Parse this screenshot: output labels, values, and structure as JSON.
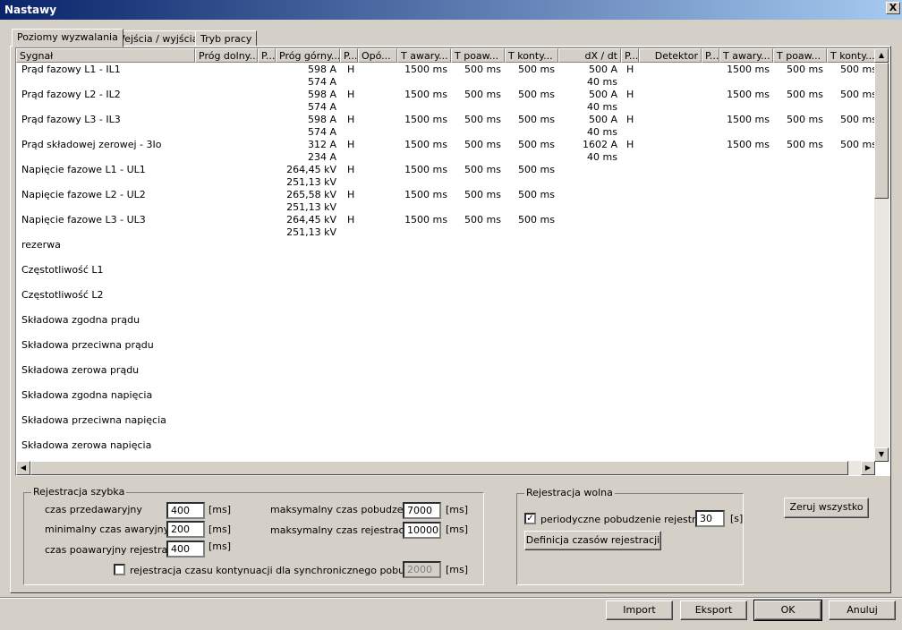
{
  "window": {
    "title": "Nastawy",
    "close_label": "X"
  },
  "tabs": [
    "Poziomy wyzwalania",
    "Wejścia / wyjścia",
    "Tryb pracy"
  ],
  "grid": {
    "headers": [
      "Sygnał",
      "Próg dolny...",
      "P...",
      "Próg górny...",
      "P...",
      "Opó...",
      "T awary...",
      "T poaw...",
      "T konty...",
      "dX / dt",
      "P...",
      "Detektor",
      "P...",
      "T awary...",
      "T poaw...",
      "T konty..."
    ],
    "rows": [
      {
        "signal": "Prąd fazowy L1 - IL1",
        "prog_gorny": "598 A",
        "prog_gorny2": "574 A",
        "p2": "H",
        "t_awar": "1500 ms",
        "t_poaw": "500 ms",
        "t_kont": "500 ms",
        "dxdt": "500 A",
        "dxdt2": "40 ms",
        "p3": "H",
        "t_awar2": "1500 ms",
        "t_poaw2": "500 ms",
        "t_kont2": "500 ms"
      },
      {
        "signal": "Prąd fazowy L2 - IL2",
        "prog_gorny": "598 A",
        "prog_gorny2": "574 A",
        "p2": "H",
        "t_awar": "1500 ms",
        "t_poaw": "500 ms",
        "t_kont": "500 ms",
        "dxdt": "500 A",
        "dxdt2": "40 ms",
        "p3": "H",
        "t_awar2": "1500 ms",
        "t_poaw2": "500 ms",
        "t_kont2": "500 ms"
      },
      {
        "signal": "Prąd fazowy L3 - IL3",
        "prog_gorny": "598 A",
        "prog_gorny2": "574 A",
        "p2": "H",
        "t_awar": "1500 ms",
        "t_poaw": "500 ms",
        "t_kont": "500 ms",
        "dxdt": "500 A",
        "dxdt2": "40 ms",
        "p3": "H",
        "t_awar2": "1500 ms",
        "t_poaw2": "500 ms",
        "t_kont2": "500 ms"
      },
      {
        "signal": "Prąd  składowej zerowej - 3Io",
        "prog_gorny": "312 A",
        "prog_gorny2": "234 A",
        "p2": "H",
        "t_awar": "1500 ms",
        "t_poaw": "500 ms",
        "t_kont": "500 ms",
        "dxdt": "1602 A",
        "dxdt2": "40 ms",
        "p3": "H",
        "t_awar2": "1500 ms",
        "t_poaw2": "500 ms",
        "t_kont2": "500 ms"
      },
      {
        "signal": "Napięcie fazowe L1 - UL1",
        "prog_gorny": "264,45 kV",
        "prog_gorny2": "251,13 kV",
        "p2": "H",
        "t_awar": "1500 ms",
        "t_poaw": "500 ms",
        "t_kont": "500 ms"
      },
      {
        "signal": "Napięcie fazowe L2 - UL2",
        "prog_gorny": "265,58 kV",
        "prog_gorny2": "251,13 kV",
        "p2": "H",
        "t_awar": "1500 ms",
        "t_poaw": "500 ms",
        "t_kont": "500 ms"
      },
      {
        "signal": "Napięcie fazowe L3 - UL3",
        "prog_gorny": "264,45 kV",
        "prog_gorny2": "251,13 kV",
        "p2": "H",
        "t_awar": "1500 ms",
        "t_poaw": "500 ms",
        "t_kont": "500 ms"
      },
      {
        "signal": "rezerwa"
      },
      {
        "signal": "Częstotliwość L1"
      },
      {
        "signal": "Częstotliwość L2"
      },
      {
        "signal": "Składowa zgodna prądu"
      },
      {
        "signal": "Składowa przeciwna prądu"
      },
      {
        "signal": "Składowa zerowa prądu"
      },
      {
        "signal": "Składowa zgodna napięcia"
      },
      {
        "signal": "Składowa przeciwna napięcia"
      },
      {
        "signal": "Składowa zerowa napięcia"
      }
    ]
  },
  "rej_szybka": {
    "title": "Rejestracja szybka",
    "czas_przedawaryjny_label": "czas przedawaryjny",
    "czas_przedawaryjny": "400",
    "min_czas_awaryjny_label": "minimalny czas awaryjny",
    "min_czas_awaryjny": "200",
    "czas_poawaryjny_label": "czas poawaryjny rejestracji",
    "czas_poawaryjny": "400",
    "max_czas_pobudzenia_label": "maksymalny czas pobudzenia",
    "max_czas_pobudzenia": "7000",
    "max_czas_rejestracji_label": "maksymalny czas rejestracji",
    "max_czas_rejestracji": "10000",
    "unit_ms": "[ms]",
    "kontynuacja_label": "rejestracja czasu kontynuacji dla synchronicznego pobudzenia",
    "kontynuacja_value": "2000",
    "kontynuacja_checked": false
  },
  "rej_wolna": {
    "title": "Rejestracja wolna",
    "periodyczne_label": "periodyczne pobudzenie rejestracji",
    "periodyczne_checked": true,
    "periodyczne_value": "30",
    "unit_s": "[s]",
    "definicja_button": "Definicja czasów rejestracji"
  },
  "buttons": {
    "zeruj": "Zeruj wszystko",
    "import": "Import",
    "eksport": "Eksport",
    "ok": "OK",
    "anuluj": "Anuluj"
  },
  "check_mark": "✓"
}
